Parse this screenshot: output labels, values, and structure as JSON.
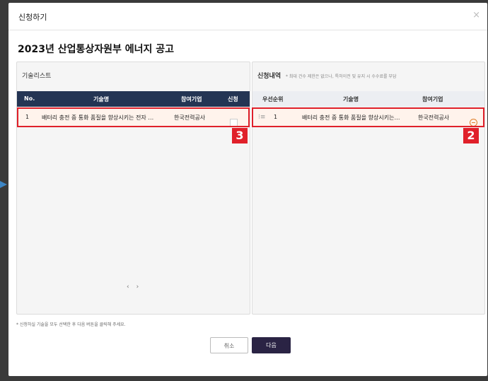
{
  "dialog": {
    "title": "신청하기",
    "close_glyph": "×",
    "heading": "2023년 산업통상자원부 에너지 공고"
  },
  "left_panel": {
    "label": "기술리스트",
    "columns": [
      "No.",
      "기술명",
      "참여기업",
      "신청"
    ],
    "rows": [
      {
        "no": "1",
        "name": "배터리 충전 중 통화 품질을 향상시키는 전자 …",
        "company": "한국전력공사"
      }
    ],
    "pager_prev": "‹",
    "pager_next": "›",
    "tag": "3"
  },
  "right_panel": {
    "label": "신청내역",
    "note": "* 최대 건수 제한은 없으나, 특허이전 및 유지 시 수수료를 부담",
    "columns": [
      "우선순위",
      "기술명",
      "참여기업"
    ],
    "rows": [
      {
        "priority": "1",
        "name": "배터리 충전 중 통화 품질을 향상시키는…",
        "company": "한국전력공사"
      }
    ],
    "tag": "2"
  },
  "footnote": "* 신청하실 기술을 모두 선택한 후 다음 버튼을 클릭해 주세요.",
  "buttons": {
    "cancel": "취소",
    "next": "다음"
  },
  "colors": {
    "accent": "#e0202a",
    "table_header": "#243554",
    "next_button": "#2a2344"
  },
  "icons": {
    "close": "close-icon",
    "drag": "drag-handle-icon",
    "remove": "remove-circle-icon"
  }
}
